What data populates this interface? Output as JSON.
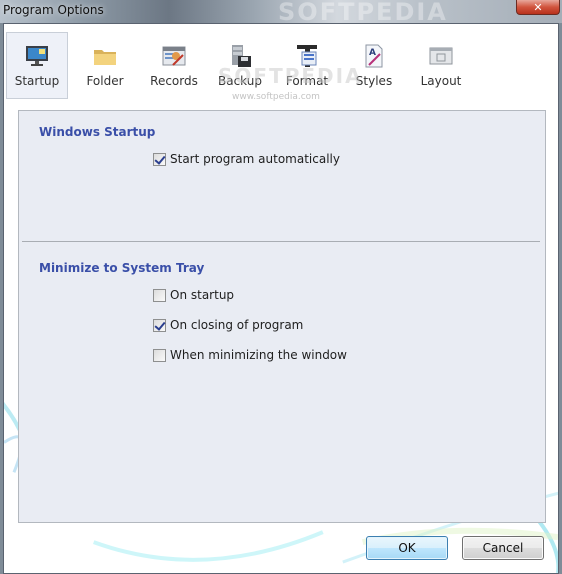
{
  "window": {
    "title": "Program Options",
    "close_label": "✕",
    "watermark": "SOFTPEDIA"
  },
  "toolbar": {
    "items": [
      {
        "label": "Startup",
        "icon": "monitor-icon",
        "active": true
      },
      {
        "label": "Folder",
        "icon": "folder-icon",
        "active": false
      },
      {
        "label": "Records",
        "icon": "records-icon",
        "active": false
      },
      {
        "label": "Backup",
        "icon": "backup-disk-icon",
        "active": false
      },
      {
        "label": "Format",
        "icon": "format-icon",
        "active": false
      },
      {
        "label": "Styles",
        "icon": "styles-icon",
        "active": false
      },
      {
        "label": "Layout",
        "icon": "layout-icon",
        "active": false
      }
    ],
    "watermark": "SOFTPEDIA",
    "watermark_url": "www.softpedia.com"
  },
  "sections": {
    "startup": {
      "title": "Windows Startup",
      "options": [
        {
          "label": "Start program automatically",
          "checked": true
        }
      ]
    },
    "tray": {
      "title": "Minimize to System Tray",
      "options": [
        {
          "label": "On startup",
          "checked": false
        },
        {
          "label": "On closing of program",
          "checked": true
        },
        {
          "label": "When minimizing the window",
          "checked": false
        }
      ]
    }
  },
  "buttons": {
    "ok": "OK",
    "cancel": "Cancel"
  }
}
